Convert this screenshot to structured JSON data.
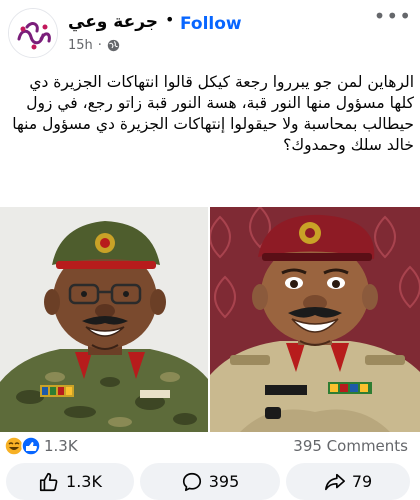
{
  "header": {
    "page_name": "جرعة وعي",
    "separator": "•",
    "follow_label": "Follow",
    "time": "15h",
    "more_label": "•••"
  },
  "post": {
    "text": "الرهاين لمن جو يبرروا رجعة كيكل قالوا انتهاكات الجزيرة دي كلها مسؤول منها النور قبة، هسة النور قبة زاتو رجع، في زول حيطالب بمحاسبة ولا حيقولوا إنتهاكات الجزيرة دي مسؤول منها خالد سلك وحمدوك؟"
  },
  "images": {
    "left_name_tag": "",
    "right_name_tag": ""
  },
  "reactions": {
    "count": "1.3K",
    "comments": "395 Comments"
  },
  "actions": {
    "like_count": "1.3K",
    "comment_count": "395",
    "share_count": "79"
  },
  "colors": {
    "follow": "#0866ff",
    "secondary_text": "#65676b",
    "action_bg": "#f0f2f5"
  }
}
